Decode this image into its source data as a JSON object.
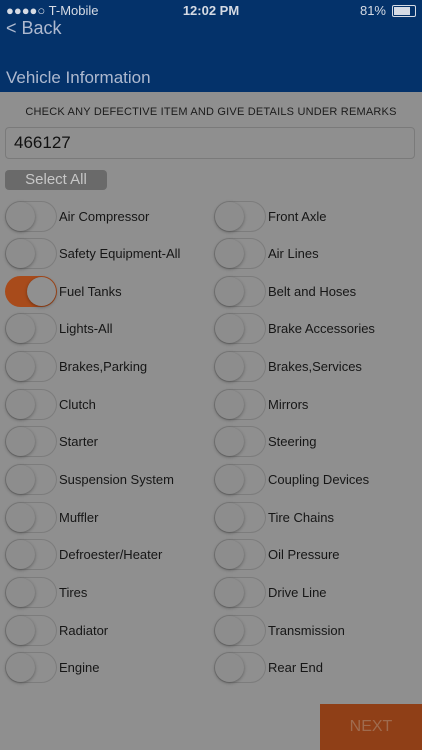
{
  "status": {
    "carrier": "●●●●○ T-Mobile",
    "time": "12:02 PM",
    "battery": "81%"
  },
  "nav": {
    "back_label": "< Back",
    "title": "Vehicle Information"
  },
  "instruction": "CHECK ANY DEFECTIVE ITEM AND GIVE DETAILS UNDER REMARKS",
  "vehicle_number": "466127",
  "select_all_label": "Select All",
  "left_items": [
    {
      "label": "Air Compressor",
      "checked": false
    },
    {
      "label": "Safety Equipment-All",
      "checked": false
    },
    {
      "label": "Fuel Tanks",
      "checked": true
    },
    {
      "label": "Lights-All",
      "checked": false
    },
    {
      "label": "Brakes,Parking",
      "checked": false
    },
    {
      "label": "Clutch",
      "checked": false
    },
    {
      "label": "Starter",
      "checked": false
    },
    {
      "label": "Suspension System",
      "checked": false
    },
    {
      "label": "Muffler",
      "checked": false
    },
    {
      "label": "Defroester/Heater",
      "checked": false
    },
    {
      "label": "Tires",
      "checked": false
    },
    {
      "label": "Radiator",
      "checked": false
    },
    {
      "label": "Engine",
      "checked": false
    }
  ],
  "right_items": [
    {
      "label": "Front Axle",
      "checked": false
    },
    {
      "label": "Air Lines",
      "checked": false
    },
    {
      "label": "Belt and Hoses",
      "checked": false
    },
    {
      "label": "Brake Accessories",
      "checked": false
    },
    {
      "label": "Brakes,Services",
      "checked": false
    },
    {
      "label": "Mirrors",
      "checked": false
    },
    {
      "label": "Steering",
      "checked": false
    },
    {
      "label": "Coupling Devices",
      "checked": false
    },
    {
      "label": "Tire Chains",
      "checked": false
    },
    {
      "label": "Oil Pressure",
      "checked": false
    },
    {
      "label": "Drive Line",
      "checked": false
    },
    {
      "label": "Transmission",
      "checked": false
    },
    {
      "label": "Rear End",
      "checked": false
    }
  ],
  "next_label": "NEXT"
}
